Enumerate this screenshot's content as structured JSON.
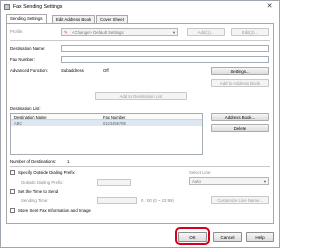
{
  "window": {
    "title": "Fax Sending Settings",
    "close_glyph": "✕"
  },
  "tabs": [
    {
      "label": "Sending Settings"
    },
    {
      "label": "Edit Address Book"
    },
    {
      "label": "Cover Sheet"
    }
  ],
  "profile": {
    "label": "Profile:",
    "value": "<Change> Default Settings",
    "add_label": "Add(1)...",
    "edit_label": "Edit(2)..."
  },
  "destination_name": {
    "label": "Destination Name:",
    "value": ""
  },
  "fax_number": {
    "label": "Fax Number:",
    "value": ""
  },
  "advanced_function": {
    "label": "Advanced Function:",
    "subaddress_label": "Subaddress",
    "subaddress_value": "Off",
    "settings_label": "Settings...",
    "add_to_address_book_label": "Add to Address Book"
  },
  "add_to_destination_list_label": "Add to Destination List",
  "destination_list": {
    "label": "Destination List:",
    "columns": [
      "Destination Name",
      "Fax Number"
    ],
    "rows": [
      {
        "name": "ABC",
        "fax": "0123456789"
      }
    ],
    "address_book_label": "Address Book...",
    "delete_label": "Delete"
  },
  "number_of_destinations": {
    "label": "Number of Destinations:",
    "value": "1"
  },
  "outside_prefix": {
    "label": "Specify Outside Dialing Prefix",
    "sublabel": "Outside Dialing Prefix:",
    "value": ""
  },
  "send_time": {
    "label": "Set the Time to Send",
    "sublabel": "Sending Time:",
    "value": "0 : 00 (0 ~ 23:59)"
  },
  "line": {
    "label": "Select Line:",
    "value": "Auto",
    "customize_label": "Customize Line Name..."
  },
  "store_sent": {
    "label": "Store Sent Fax Information and Image"
  },
  "footer": {
    "ok": "OK",
    "cancel": "Cancel",
    "help": "Help"
  },
  "colors": {
    "highlight": "#d6001c"
  }
}
